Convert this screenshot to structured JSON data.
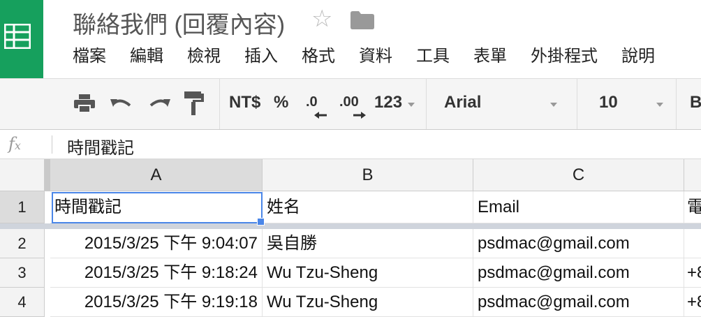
{
  "app": {
    "title": "聯絡我們 (回覆內容)",
    "accent": "#16a05d",
    "icons": [
      "sheets-logo-icon",
      "star-icon",
      "folder-icon"
    ]
  },
  "menu": [
    "檔案",
    "編輯",
    "檢視",
    "插入",
    "格式",
    "資料",
    "工具",
    "表單",
    "外掛程式",
    "說明"
  ],
  "toolbar": {
    "currency": "NT$",
    "percent": "%",
    "decimal_decrease": ".0",
    "decimal_increase": ".00",
    "more_formats": "123",
    "font": "Arial",
    "font_size": "10",
    "next_partial": "B",
    "icons": [
      "print-icon",
      "undo-icon",
      "redo-icon",
      "paint-format-icon"
    ]
  },
  "formula_bar": {
    "fx_label": "fx",
    "value": "時間戳記"
  },
  "grid": {
    "columns": [
      "A",
      "B",
      "C",
      ""
    ],
    "rows": [
      {
        "num": "1",
        "cells": [
          "時間戳記",
          "姓名",
          "Email",
          "電"
        ]
      },
      {
        "num": "2",
        "cells": [
          "2015/3/25 下午 9:04:07",
          "吳自勝",
          "psdmac@gmail.com",
          ""
        ]
      },
      {
        "num": "3",
        "cells": [
          "2015/3/25 下午 9:18:24",
          "Wu Tzu-Sheng",
          "psdmac@gmail.com",
          "+8"
        ]
      },
      {
        "num": "4",
        "cells": [
          "2015/3/25 下午 9:19:18",
          "Wu Tzu-Sheng",
          "psdmac@gmail.com",
          "+8"
        ]
      }
    ],
    "selected_cell": "A1"
  }
}
